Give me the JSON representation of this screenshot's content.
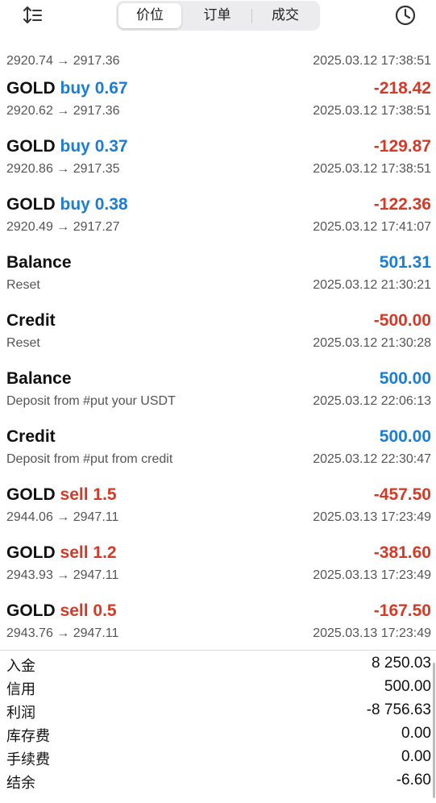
{
  "toolbar": {
    "sort_icon": "sort-icon",
    "history_icon": "clock-icon",
    "tabs": [
      {
        "label": "价位",
        "active": true
      },
      {
        "label": "订单",
        "active": false
      },
      {
        "label": "成交",
        "active": false
      }
    ]
  },
  "colors": {
    "buy": "#1a7ed6",
    "sell": "#d63a26",
    "positive": "#1a7ed6",
    "negative": "#d63a26"
  },
  "rows": [
    {
      "symbol": "",
      "side": "",
      "volume": "",
      "amount": "",
      "sign": "neg",
      "detail": "2920.74 → 2917.36",
      "time": "2025.03.12 17:38:51"
    },
    {
      "symbol": "GOLD",
      "side": "buy",
      "volume": "0.67",
      "amount": "-218.42",
      "sign": "neg",
      "detail": "2920.62 → 2917.36",
      "time": "2025.03.12 17:38:51"
    },
    {
      "symbol": "GOLD",
      "side": "buy",
      "volume": "0.37",
      "amount": "-129.87",
      "sign": "neg",
      "detail": "2920.86 → 2917.35",
      "time": "2025.03.12 17:38:51"
    },
    {
      "symbol": "GOLD",
      "side": "buy",
      "volume": "0.38",
      "amount": "-122.36",
      "sign": "neg",
      "detail": "2920.49 → 2917.27",
      "time": "2025.03.12 17:41:07"
    },
    {
      "symbol": "Balance",
      "side": "",
      "volume": "",
      "amount": "501.31",
      "sign": "pos",
      "detail": "Reset",
      "time": "2025.03.12 21:30:21"
    },
    {
      "symbol": "Credit",
      "side": "",
      "volume": "",
      "amount": "-500.00",
      "sign": "neg",
      "detail": "Reset",
      "time": "2025.03.12 21:30:28"
    },
    {
      "symbol": "Balance",
      "side": "",
      "volume": "",
      "amount": "500.00",
      "sign": "pos",
      "detail": "Deposit from #put your USDT",
      "time": "2025.03.12 22:06:13"
    },
    {
      "symbol": "Credit",
      "side": "",
      "volume": "",
      "amount": "500.00",
      "sign": "pos",
      "detail": "Deposit from #put from credit",
      "time": "2025.03.12 22:30:47"
    },
    {
      "symbol": "GOLD",
      "side": "sell",
      "volume": "1.5",
      "amount": "-457.50",
      "sign": "neg",
      "detail": "2944.06 → 2947.11",
      "time": "2025.03.13 17:23:49"
    },
    {
      "symbol": "GOLD",
      "side": "sell",
      "volume": "1.2",
      "amount": "-381.60",
      "sign": "neg",
      "detail": "2943.93 → 2947.11",
      "time": "2025.03.13 17:23:49"
    },
    {
      "symbol": "GOLD",
      "side": "sell",
      "volume": "0.5",
      "amount": "-167.50",
      "sign": "neg",
      "detail": "2943.76 → 2947.11",
      "time": "2025.03.13 17:23:49"
    }
  ],
  "summary": [
    {
      "label": "入金",
      "value": "8 250.03"
    },
    {
      "label": "信用",
      "value": "500.00"
    },
    {
      "label": "利润",
      "value": "-8 756.63"
    },
    {
      "label": "库存费",
      "value": "0.00"
    },
    {
      "label": "手续费",
      "value": "0.00"
    },
    {
      "label": "结余",
      "value": "-6.60"
    }
  ]
}
